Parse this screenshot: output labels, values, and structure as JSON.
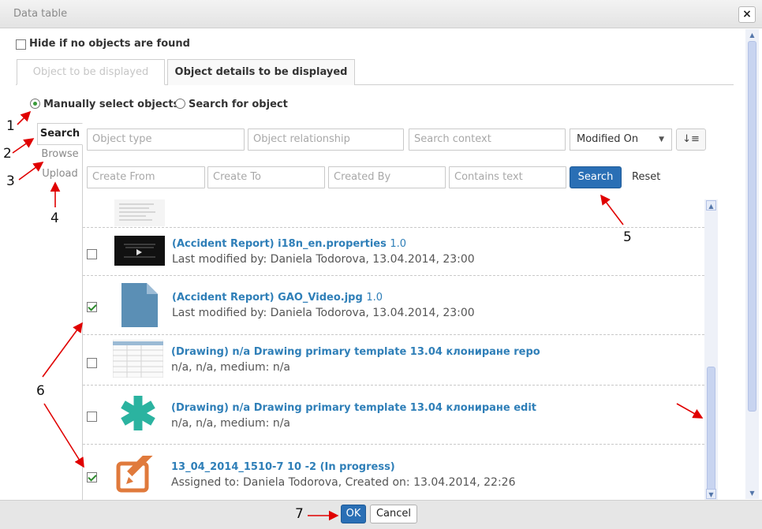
{
  "dialog": {
    "title": "Data table",
    "close_icon": "×"
  },
  "options": {
    "hide_if_none_label": "Hide if no objects are found",
    "tabs": [
      "Object to be displayed",
      "Object details to be displayed"
    ],
    "radio_manual": "Manually select objects",
    "radio_search": "Search for object"
  },
  "left_tabs": [
    "Search",
    "Browse",
    "Upload"
  ],
  "filters": {
    "object_type": "Object type",
    "object_relationship": "Object relationship",
    "search_context": "Search context",
    "sort_select": "Modified On",
    "sort_icon": "↓≡",
    "create_from": "Create From",
    "create_to": "Create To",
    "created_by": "Created By",
    "contains_text": "Contains text",
    "search_button": "Search",
    "reset_link": "Reset"
  },
  "results": [
    {
      "title": "(Accident Report) i18n_en.properties",
      "version": "1.0",
      "meta": "Last modified by: Daniela Todorova, 13.04.2014, 23:00",
      "checked": false,
      "thumb": "video-thumbnail"
    },
    {
      "title": "(Accident Report) GAO_Video.jpg",
      "version": "1.0",
      "meta": "Last modified by: Daniela Todorova, 13.04.2014, 23:00",
      "checked": true,
      "thumb": "document-icon"
    },
    {
      "title": "(Drawing) n/a Drawing primary template 13.04 клониране repo",
      "version": "",
      "meta": "n/a, n/a, medium: n/a",
      "checked": false,
      "thumb": "table-thumbnail"
    },
    {
      "title": "(Drawing) n/a Drawing primary template 13.04 клониране edit",
      "version": "",
      "meta": "n/a, n/a, medium: n/a",
      "checked": false,
      "thumb": "asterisk-icon"
    },
    {
      "title": "13_04_2014_1510-7 10 -2 (In progress)",
      "version": "",
      "meta": "Assigned to: Daniela Todorova, Created on: 13.04.2014, 22:26",
      "checked": true,
      "thumb": "edit-icon"
    }
  ],
  "footer": {
    "ok": "OK",
    "cancel": "Cancel"
  },
  "annotations": [
    "1",
    "2",
    "3",
    "4",
    "5",
    "6",
    "7"
  ],
  "colors": {
    "accent": "#2a6fb5",
    "link": "#2f7fb8",
    "arrow": "#e00000",
    "thumb_teal": "#2bb3a0",
    "thumb_orange": "#e07a3c",
    "doc_blue": "#5b8fb5"
  }
}
